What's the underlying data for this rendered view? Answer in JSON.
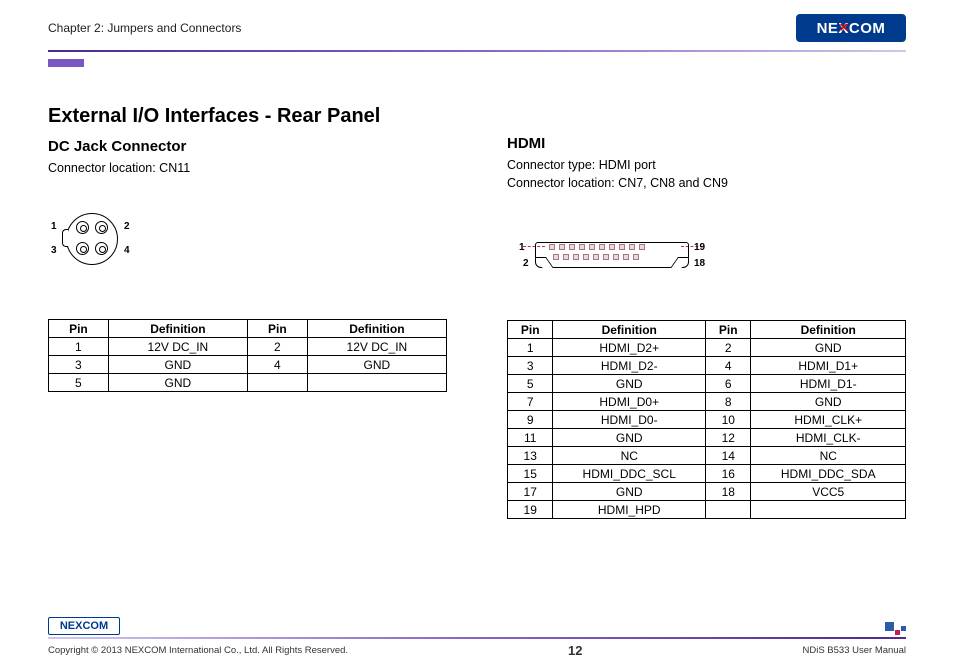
{
  "header": {
    "chapter": "Chapter 2: Jumpers and Connectors",
    "logo": "NEXCOM"
  },
  "title": "External I/O Interfaces - Rear Panel",
  "dc": {
    "title": "DC Jack Connector",
    "location": "Connector location: CN11",
    "labels": {
      "p1": "1",
      "p2": "2",
      "p3": "3",
      "p4": "4"
    },
    "table": {
      "headers": [
        "Pin",
        "Definition",
        "Pin",
        "Definition"
      ],
      "rows": [
        [
          "1",
          "12V DC_IN",
          "2",
          "12V DC_IN"
        ],
        [
          "3",
          "GND",
          "4",
          "GND"
        ],
        [
          "5",
          "GND",
          "",
          ""
        ]
      ]
    }
  },
  "hdmi": {
    "title": "HDMI",
    "type": "Connector type: HDMI port",
    "location": "Connector location: CN7, CN8 and CN9",
    "labels": {
      "p1": "1",
      "p2": "2",
      "p18": "18",
      "p19": "19"
    },
    "table": {
      "headers": [
        "Pin",
        "Definition",
        "Pin",
        "Definition"
      ],
      "rows": [
        [
          "1",
          "HDMI_D2+",
          "2",
          "GND"
        ],
        [
          "3",
          "HDMI_D2-",
          "4",
          "HDMI_D1+"
        ],
        [
          "5",
          "GND",
          "6",
          "HDMI_D1-"
        ],
        [
          "7",
          "HDMI_D0+",
          "8",
          "GND"
        ],
        [
          "9",
          "HDMI_D0-",
          "10",
          "HDMI_CLK+"
        ],
        [
          "11",
          "GND",
          "12",
          "HDMI_CLK-"
        ],
        [
          "13",
          "NC",
          "14",
          "NC"
        ],
        [
          "15",
          "HDMI_DDC_SCL",
          "16",
          "HDMI_DDC_SDA"
        ],
        [
          "17",
          "GND",
          "18",
          "VCC5"
        ],
        [
          "19",
          "HDMI_HPD",
          "",
          ""
        ]
      ]
    }
  },
  "footer": {
    "logo": "NEXCOM",
    "copyright": "Copyright © 2013 NEXCOM International Co., Ltd. All Rights Reserved.",
    "page": "12",
    "manual": "NDiS B533 User Manual"
  }
}
